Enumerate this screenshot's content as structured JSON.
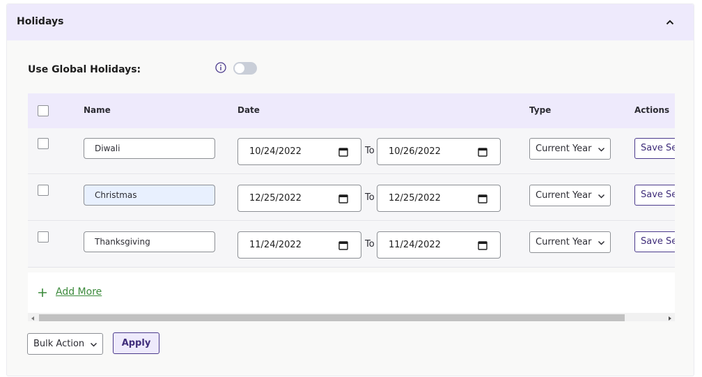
{
  "panel": {
    "title": "Holidays",
    "collapse_icon": "chevron-up-icon"
  },
  "global_holidays": {
    "label": "Use Global Holidays:",
    "info_icon": "info-icon",
    "toggle_on": false
  },
  "table": {
    "headers": {
      "name": "Name",
      "date": "Date",
      "type": "Type",
      "actions": "Actions"
    },
    "rows": [
      {
        "checked": false,
        "name": "Diwali",
        "date_from": "10/24/2022",
        "to_label": "To",
        "date_to": "10/26/2022",
        "type": "Current Year",
        "action": "Save Se"
      },
      {
        "checked": false,
        "name": "Christmas",
        "date_from": "12/25/2022",
        "to_label": "To",
        "date_to": "12/25/2022",
        "type": "Current Year",
        "action": "Save Se"
      },
      {
        "checked": false,
        "name": "Thanksgiving",
        "date_from": "11/24/2022",
        "to_label": "To",
        "date_to": "11/24/2022",
        "type": "Current Year",
        "action": "Save Se"
      }
    ],
    "add_more": "Add More"
  },
  "footer": {
    "bulk_action": "Bulk Action",
    "apply": "Apply"
  },
  "colors": {
    "header_bg": "#eeeafc",
    "accent": "#4b3a8c",
    "link_green": "#3b8a3b"
  }
}
